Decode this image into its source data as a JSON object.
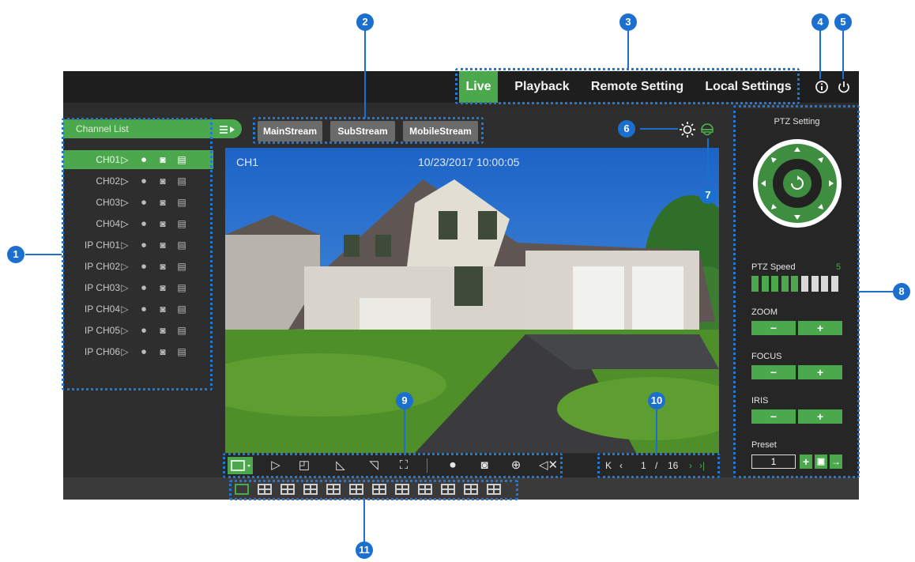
{
  "nav": {
    "live": "Live",
    "playback": "Playback",
    "remote_setting": "Remote Setting",
    "local_settings": "Local Settings"
  },
  "sidebar": {
    "title": "Channel List",
    "channels": [
      {
        "name": "CH01",
        "selected": true
      },
      {
        "name": "CH02"
      },
      {
        "name": "CH03"
      },
      {
        "name": "CH04"
      },
      {
        "name": "IP CH01"
      },
      {
        "name": "IP CH02"
      },
      {
        "name": "IP CH03"
      },
      {
        "name": "IP CH04"
      },
      {
        "name": "IP CH05"
      },
      {
        "name": "IP CH06"
      }
    ]
  },
  "streams": {
    "main": "MainStream",
    "sub": "SubStream",
    "mobile": "MobileStream"
  },
  "video": {
    "channel_label": "CH1",
    "timestamp": "10/23/2017 10:00:05"
  },
  "pagination": {
    "current": "1",
    "separator": "/",
    "total": "16"
  },
  "ptz": {
    "title": "PTZ Setting",
    "speed_label": "PTZ Speed",
    "speed_value": "5",
    "speed_level": 5,
    "speed_max": 9,
    "zoom_label": "ZOOM",
    "focus_label": "FOCUS",
    "iris_label": "IRIS",
    "minus": "−",
    "plus": "+",
    "preset_label": "Preset",
    "preset_value": "1"
  },
  "callouts": [
    "1",
    "2",
    "3",
    "4",
    "5",
    "6",
    "7",
    "8",
    "9",
    "10",
    "11"
  ],
  "colors": {
    "accent": "#4ca84c",
    "callout": "#1a6fcf",
    "background": "#2e2e2e"
  },
  "icons": [
    "play-icon",
    "record-icon",
    "snapshot-icon",
    "window-icon",
    "info-icon",
    "power-icon",
    "color-adjust-icon",
    "ptz-icon",
    "refresh-icon",
    "zoom-in-icon",
    "mute-icon",
    "first-page-icon",
    "prev-page-icon",
    "next-page-icon",
    "last-page-icon"
  ]
}
